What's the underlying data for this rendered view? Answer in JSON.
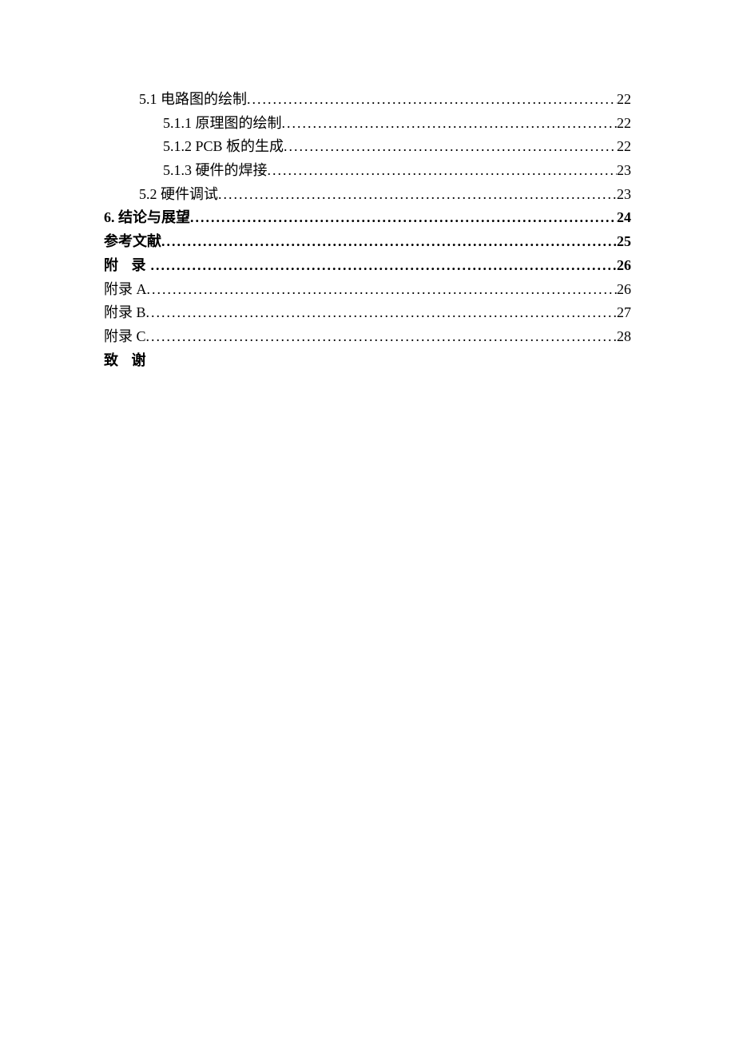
{
  "toc": {
    "entries": [
      {
        "label": "5.1  电路图的绘制",
        "page": "22",
        "indent": 1,
        "bold": false
      },
      {
        "label": "5.1.1  原理图的绘制",
        "page": "22",
        "indent": 2,
        "bold": false
      },
      {
        "label": "5.1.2 PCB 板的生成",
        "page": "22",
        "indent": 2,
        "bold": false
      },
      {
        "label": "5.1.3  硬件的焊接",
        "page": "23",
        "indent": 2,
        "bold": false
      },
      {
        "label": "5.2 硬件调试",
        "page": "23",
        "indent": 1,
        "bold": false
      },
      {
        "label": "6.  结论与展望",
        "page": "24",
        "indent": 0,
        "bold": true
      },
      {
        "label": "参考文献",
        "page": "25",
        "indent": 0,
        "bold": true
      },
      {
        "label": "附 录",
        "page": "26",
        "indent": 0,
        "bold": true,
        "ls": true
      },
      {
        "label": "附录 A",
        "page": "26",
        "indent": 0,
        "bold": false
      },
      {
        "label": "附录 B",
        "page": "27",
        "indent": 0,
        "bold": false
      },
      {
        "label": "附录 C",
        "page": "28",
        "indent": 0,
        "bold": false
      },
      {
        "label": "致 谢",
        "page": "",
        "indent": 0,
        "bold": true,
        "nodots": true,
        "ls": true
      }
    ]
  }
}
